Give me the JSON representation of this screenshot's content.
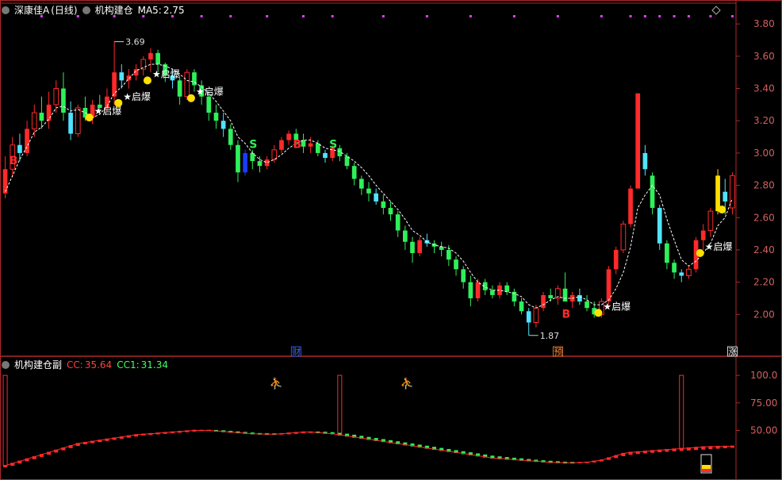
{
  "main_header": {
    "stock_name": "深康佳A",
    "period": "(日线)",
    "indicator": "机构建仓",
    "ma_label": "MA5:",
    "ma_value": "2.75"
  },
  "sub_header": {
    "indicator": "机构建仓副",
    "cc_label": "CC:",
    "cc_value": "35.64",
    "cc1_label": "CC1:",
    "cc1_value": "31.34"
  },
  "colors": {
    "up": "#ff2a2a",
    "down": "#2ef05a",
    "cyan": "#4fe3ff",
    "blue": "#1a3cff",
    "yellow": "#ffe000",
    "magenta": "#e040ff",
    "axis": "#b0282a",
    "ma": "#ffffff",
    "text_axis": "#d06060"
  },
  "chart_data": [
    {
      "type": "candlestick",
      "title": "",
      "ylim": [
        1.8,
        3.85
      ],
      "y_ticks": [
        "3.80",
        "3.60",
        "3.40",
        "3.20",
        "3.00",
        "2.80",
        "2.60",
        "2.40",
        "2.20",
        "2.00"
      ],
      "y_tick_values": [
        3.8,
        3.6,
        3.4,
        3.2,
        3.0,
        2.8,
        2.6,
        2.4,
        2.2,
        2.0
      ],
      "ohlc": [
        [
          2.75,
          2.98,
          2.72,
          2.9
        ],
        [
          2.9,
          3.1,
          2.85,
          3.05
        ],
        [
          3.05,
          3.12,
          2.95,
          3.0
        ],
        [
          3.0,
          3.2,
          2.98,
          3.15
        ],
        [
          3.15,
          3.3,
          3.1,
          3.25
        ],
        [
          3.25,
          3.35,
          3.15,
          3.2
        ],
        [
          3.2,
          3.38,
          3.15,
          3.3
        ],
        [
          3.3,
          3.45,
          3.25,
          3.4
        ],
        [
          3.4,
          3.5,
          3.2,
          3.25
        ],
        [
          3.25,
          3.32,
          3.08,
          3.12
        ],
        [
          3.12,
          3.3,
          3.1,
          3.28
        ],
        [
          3.28,
          3.35,
          3.2,
          3.22
        ],
        [
          3.22,
          3.33,
          3.18,
          3.3
        ],
        [
          3.3,
          3.36,
          3.25,
          3.28
        ],
        [
          3.28,
          3.4,
          3.26,
          3.35
        ],
        [
          3.35,
          3.69,
          3.3,
          3.5
        ],
        [
          3.5,
          3.55,
          3.4,
          3.45
        ],
        [
          3.45,
          3.52,
          3.4,
          3.48
        ],
        [
          3.48,
          3.55,
          3.45,
          3.52
        ],
        [
          3.52,
          3.6,
          3.48,
          3.58
        ],
        [
          3.58,
          3.65,
          3.5,
          3.62
        ],
        [
          3.62,
          3.64,
          3.5,
          3.55
        ],
        [
          3.55,
          3.56,
          3.44,
          3.48
        ],
        [
          3.48,
          3.52,
          3.4,
          3.45
        ],
        [
          3.45,
          3.48,
          3.3,
          3.35
        ],
        [
          3.35,
          3.52,
          3.33,
          3.5
        ],
        [
          3.5,
          3.52,
          3.38,
          3.42
        ],
        [
          3.42,
          3.45,
          3.3,
          3.35
        ],
        [
          3.35,
          3.38,
          3.2,
          3.25
        ],
        [
          3.25,
          3.3,
          3.15,
          3.2
        ],
        [
          3.2,
          3.25,
          3.1,
          3.15
        ],
        [
          3.15,
          3.18,
          3.02,
          3.05
        ],
        [
          3.05,
          3.08,
          2.82,
          2.88
        ],
        [
          2.88,
          3.02,
          2.86,
          3.0
        ],
        [
          3.0,
          3.02,
          2.9,
          2.95
        ],
        [
          2.95,
          2.98,
          2.88,
          2.92
        ],
        [
          2.92,
          2.98,
          2.9,
          2.96
        ],
        [
          2.96,
          3.05,
          2.94,
          3.02
        ],
        [
          3.02,
          3.1,
          3.0,
          3.08
        ],
        [
          3.08,
          3.14,
          3.05,
          3.12
        ],
        [
          3.12,
          3.15,
          3.05,
          3.08
        ],
        [
          3.08,
          3.12,
          3.0,
          3.04
        ],
        [
          3.04,
          3.1,
          3.0,
          3.06
        ],
        [
          3.06,
          3.08,
          2.98,
          3.0
        ],
        [
          3.0,
          3.02,
          2.94,
          2.97
        ],
        [
          2.97,
          3.05,
          2.95,
          3.03
        ],
        [
          3.03,
          3.05,
          2.95,
          2.98
        ],
        [
          2.98,
          3.0,
          2.9,
          2.92
        ],
        [
          2.92,
          2.94,
          2.8,
          2.84
        ],
        [
          2.84,
          2.86,
          2.74,
          2.78
        ],
        [
          2.78,
          2.82,
          2.7,
          2.75
        ],
        [
          2.75,
          2.78,
          2.68,
          2.7
        ],
        [
          2.7,
          2.74,
          2.62,
          2.66
        ],
        [
          2.66,
          2.7,
          2.58,
          2.62
        ],
        [
          2.62,
          2.64,
          2.48,
          2.52
        ],
        [
          2.52,
          2.55,
          2.4,
          2.45
        ],
        [
          2.45,
          2.48,
          2.32,
          2.38
        ],
        [
          2.38,
          2.48,
          2.36,
          2.46
        ],
        [
          2.46,
          2.5,
          2.42,
          2.44
        ],
        [
          2.44,
          2.46,
          2.38,
          2.42
        ],
        [
          2.42,
          2.45,
          2.36,
          2.4
        ],
        [
          2.4,
          2.43,
          2.3,
          2.34
        ],
        [
          2.34,
          2.36,
          2.24,
          2.28
        ],
        [
          2.28,
          2.3,
          2.16,
          2.2
        ],
        [
          2.2,
          2.24,
          2.05,
          2.1
        ],
        [
          2.1,
          2.22,
          2.08,
          2.2
        ],
        [
          2.2,
          2.22,
          2.12,
          2.15
        ],
        [
          2.15,
          2.18,
          2.1,
          2.12
        ],
        [
          2.12,
          2.2,
          2.1,
          2.18
        ],
        [
          2.18,
          2.2,
          2.12,
          2.14
        ],
        [
          2.14,
          2.16,
          2.05,
          2.08
        ],
        [
          2.08,
          2.1,
          2.0,
          2.02
        ],
        [
          2.02,
          2.04,
          1.87,
          1.95
        ],
        [
          1.95,
          2.06,
          1.92,
          2.04
        ],
        [
          2.04,
          2.14,
          2.02,
          2.12
        ],
        [
          2.12,
          2.16,
          2.08,
          2.1
        ],
        [
          2.1,
          2.18,
          2.06,
          2.16
        ],
        [
          2.16,
          2.26,
          2.12,
          2.08
        ],
        [
          2.08,
          2.14,
          2.04,
          2.12
        ],
        [
          2.12,
          2.16,
          2.06,
          2.08
        ],
        [
          2.08,
          2.12,
          2.02,
          2.04
        ],
        [
          2.04,
          2.08,
          1.98,
          2.0
        ],
        [
          2.0,
          2.1,
          1.98,
          2.08
        ],
        [
          2.08,
          2.3,
          2.06,
          2.28
        ],
        [
          2.28,
          2.42,
          2.25,
          2.4
        ],
        [
          2.4,
          2.58,
          2.38,
          2.56
        ],
        [
          2.56,
          2.8,
          2.54,
          2.78
        ],
        [
          2.78,
          3.37,
          2.95,
          3.37
        ],
        [
          3.0,
          3.05,
          2.86,
          2.9
        ],
        [
          2.86,
          2.88,
          2.62,
          2.66
        ],
        [
          2.66,
          2.68,
          2.4,
          2.44
        ],
        [
          2.44,
          2.46,
          2.28,
          2.32
        ],
        [
          2.32,
          2.34,
          2.22,
          2.26
        ],
        [
          2.26,
          2.28,
          2.2,
          2.24
        ],
        [
          2.24,
          2.3,
          2.22,
          2.28
        ],
        [
          2.28,
          2.48,
          2.26,
          2.46
        ],
        [
          2.46,
          2.56,
          2.4,
          2.52
        ],
        [
          2.52,
          2.66,
          2.48,
          2.64
        ],
        [
          2.64,
          2.9,
          2.62,
          2.86
        ],
        [
          2.76,
          2.84,
          2.62,
          2.7
        ],
        [
          2.66,
          2.88,
          2.62,
          2.86
        ]
      ],
      "ma5": [
        2.76,
        2.86,
        2.96,
        3.04,
        3.13,
        3.16,
        3.21,
        3.28,
        3.29,
        3.26,
        3.27,
        3.25,
        3.22,
        3.24,
        3.29,
        3.37,
        3.41,
        3.46,
        3.51,
        3.53,
        3.55,
        3.55,
        3.54,
        3.52,
        3.49,
        3.45,
        3.44,
        3.41,
        3.37,
        3.32,
        3.26,
        3.2,
        3.1,
        3.06,
        3.0,
        2.96,
        2.94,
        2.96,
        2.99,
        3.03,
        3.06,
        3.08,
        3.08,
        3.06,
        3.03,
        3.02,
        3.01,
        2.98,
        2.95,
        2.91,
        2.86,
        2.8,
        2.75,
        2.7,
        2.65,
        2.59,
        2.52,
        2.49,
        2.45,
        2.43,
        2.42,
        2.41,
        2.38,
        2.33,
        2.26,
        2.2,
        2.17,
        2.15,
        2.15,
        2.14,
        2.13,
        2.11,
        2.06,
        2.04,
        2.06,
        2.09,
        2.11,
        2.1,
        2.1,
        2.11,
        2.09,
        2.06,
        2.06,
        2.09,
        2.16,
        2.26,
        2.42,
        2.66,
        2.74,
        2.8,
        2.74,
        2.59,
        2.46,
        2.34,
        2.3,
        2.33,
        2.38,
        2.44,
        2.55,
        2.6,
        2.72
      ],
      "markers": [
        {
          "kind": "dot",
          "index": 12,
          "price": 3.22,
          "label": "启爆"
        },
        {
          "kind": "dot",
          "index": 16,
          "price": 3.31,
          "label": "启爆"
        },
        {
          "kind": "dot",
          "index": 20,
          "price": 3.45,
          "label": "启爆"
        },
        {
          "kind": "dot",
          "index": 26,
          "price": 3.34,
          "label": "启爆"
        },
        {
          "kind": "dot",
          "index": 82,
          "price": 2.01,
          "label": "启爆"
        },
        {
          "kind": "dot",
          "index": 96,
          "price": 2.38,
          "label": "启爆"
        },
        {
          "kind": "dot",
          "index": 99,
          "price": 2.65,
          "label": ""
        },
        {
          "kind": "letter",
          "index": 1,
          "price": 2.95,
          "label": "B",
          "color": "#ff2a2a"
        },
        {
          "kind": "letter",
          "index": 34,
          "price": 3.05,
          "label": "S",
          "color": "#2ef05a"
        },
        {
          "kind": "letter",
          "index": 40,
          "price": 3.05,
          "label": "B",
          "color": "#ff2a2a"
        },
        {
          "kind": "letter",
          "index": 45,
          "price": 3.05,
          "label": "S",
          "color": "#2ef05a"
        },
        {
          "kind": "letter",
          "index": 77,
          "price": 2.0,
          "label": "B",
          "color": "#ff2a2a"
        }
      ],
      "extremes": [
        {
          "label": "3.69",
          "index": 15,
          "price": 3.69,
          "side": "high"
        },
        {
          "label": "1.87",
          "index": 72,
          "price": 1.87,
          "side": "low"
        }
      ],
      "bottom_tags": [
        {
          "label": "财",
          "index": 40,
          "color": "#3a6cff"
        },
        {
          "label": "预",
          "index": 76,
          "color": "#ff8c3a"
        },
        {
          "label": "涨",
          "index": 100,
          "color": "#ffffff"
        }
      ],
      "signal_row_indices": [
        5,
        10,
        15,
        19,
        23,
        27,
        31,
        36,
        41,
        45,
        52,
        58,
        64,
        70,
        76,
        82,
        86,
        88,
        90,
        92,
        94,
        97,
        100
      ]
    },
    {
      "type": "area",
      "title": "机构建仓副",
      "ylim": [
        10,
        108
      ],
      "y_ticks": [
        "100.0",
        "75.00",
        "50.00"
      ],
      "y_tick_values": [
        100,
        75,
        50
      ],
      "cc": [
        18,
        20,
        22,
        24,
        26,
        28,
        30,
        32,
        34,
        36,
        38,
        39,
        40,
        41,
        42,
        43,
        44,
        45,
        46,
        46.5,
        47,
        47.5,
        48,
        48.5,
        49,
        49.5,
        50,
        50,
        50,
        49.5,
        49,
        48.5,
        48,
        47.5,
        47,
        46.8,
        46.5,
        46.5,
        47,
        47.5,
        48,
        48.5,
        48.5,
        48,
        47.5,
        47,
        46,
        45,
        44,
        43,
        42,
        41,
        40,
        39,
        38,
        37,
        36,
        35,
        34,
        33,
        32,
        31,
        30,
        29,
        28,
        27,
        26,
        25,
        24.5,
        24,
        23.5,
        23,
        22.5,
        22,
        21.5,
        21,
        20.8,
        20.5,
        20.5,
        20.8,
        21,
        22,
        23,
        25,
        27,
        29,
        30,
        30.5,
        31,
        31.5,
        32,
        32.5,
        33,
        33.5,
        34,
        34.5,
        35,
        35.2,
        35.4,
        35.5,
        35.64
      ],
      "cc1": [
        17,
        18.5,
        20.5,
        22.5,
        24.5,
        26.5,
        28.5,
        30.5,
        32.5,
        34.5,
        36.5,
        38,
        39,
        40,
        41,
        42,
        43,
        44,
        45,
        46,
        46.5,
        47,
        47.5,
        48,
        48.5,
        49,
        49.5,
        50,
        50,
        49.8,
        49.5,
        49,
        48.5,
        48,
        47.5,
        47,
        46.8,
        46.7,
        46.8,
        47,
        47.5,
        48,
        48.3,
        48.4,
        48.2,
        47.8,
        47.2,
        46.4,
        45.5,
        44.5,
        43.5,
        42.5,
        41.5,
        40.5,
        39.5,
        38.5,
        37.5,
        36.5,
        35.5,
        34.5,
        33.5,
        32.5,
        31.5,
        30.5,
        29.5,
        28.5,
        27.5,
        26.5,
        25.8,
        25.2,
        24.6,
        24,
        23.4,
        22.8,
        22.3,
        21.8,
        21.4,
        21,
        20.8,
        20.8,
        20.9,
        21.5,
        22.4,
        23.8,
        25.5,
        27.2,
        28.5,
        29.2,
        29.8,
        30.3,
        30.8,
        31.2,
        31.6,
        32,
        32.4,
        32.8,
        33.2,
        33.6,
        34,
        34.4,
        34.8,
        31.34
      ],
      "spikes": [
        0,
        46,
        93
      ],
      "spike_value": 100,
      "figures": [
        37,
        55
      ]
    }
  ]
}
